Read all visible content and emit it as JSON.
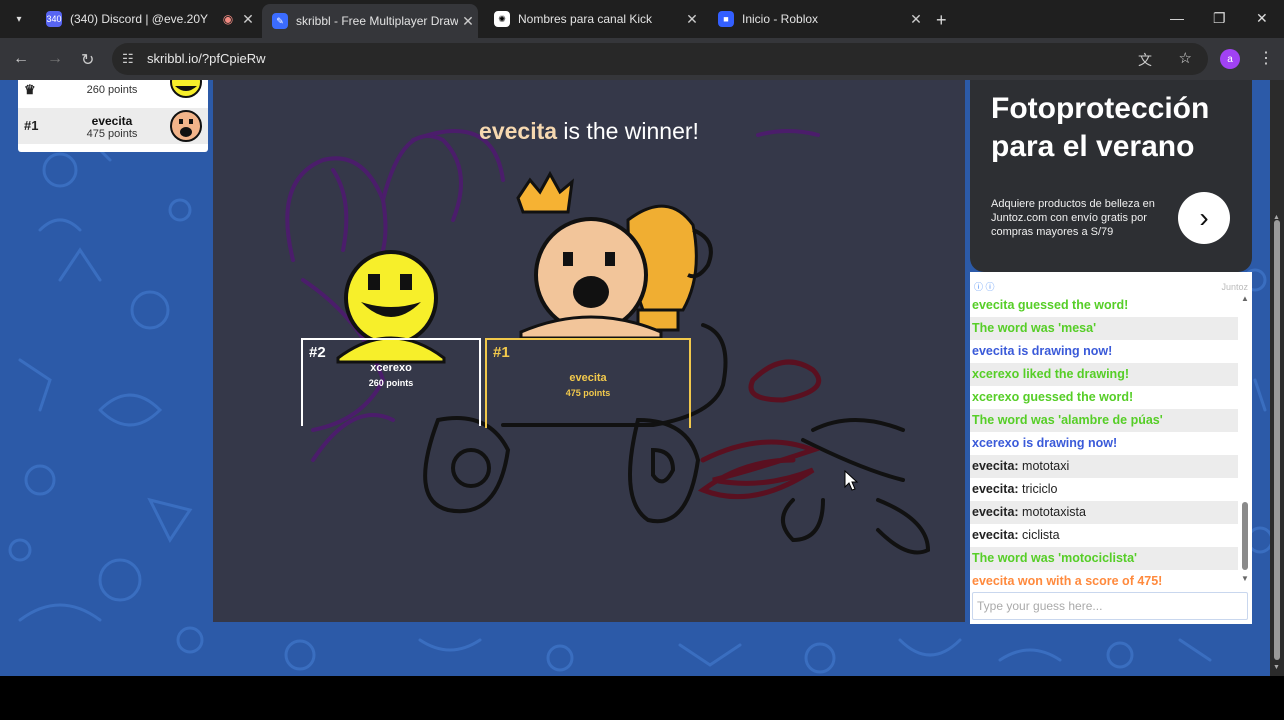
{
  "browser": {
    "tabs": [
      {
        "title": "(340) Discord | @eve.20Y",
        "badge": "340",
        "favicon_color": "#5865f2"
      },
      {
        "title": "skribbl - Free Multiplayer Drawi",
        "favicon_color": "#3b6cff"
      },
      {
        "title": "Nombres para canal Kick",
        "favicon_color": "#ffffff"
      },
      {
        "title": "Inicio - Roblox",
        "favicon_color": "#335fff"
      }
    ],
    "url": "skribbl.io/?pfCpieRw",
    "profile_initial": "a"
  },
  "players": [
    {
      "rank": "",
      "name": "",
      "points": "260 points"
    },
    {
      "rank": "#1",
      "name": "evecita",
      "points": "475 points"
    }
  ],
  "winner": {
    "name": "evecita",
    "suffix": " is the winner!"
  },
  "podium": [
    {
      "rank": "#2",
      "name": "xcerexo",
      "points": "260 points"
    },
    {
      "rank": "#1",
      "name": "evecita",
      "points": "475 points"
    }
  ],
  "ad": {
    "headline": "Fotoprotección para el verano",
    "body": "Adquiere productos de belleza en Juntoz.com con envío gratis por compras mayores a S/79",
    "brand": "Juntoz"
  },
  "chat": {
    "messages": [
      {
        "style": "green",
        "user": "",
        "text": "evecita guessed the word!"
      },
      {
        "style": "green",
        "user": "",
        "text": "The word was 'mesa'"
      },
      {
        "style": "blue",
        "user": "",
        "text": "evecita is drawing now!"
      },
      {
        "style": "green",
        "user": "",
        "text": "xcerexo liked the drawing!"
      },
      {
        "style": "green",
        "user": "",
        "text": "xcerexo guessed the word!"
      },
      {
        "style": "green",
        "user": "",
        "text": "The word was 'alambre de púas'"
      },
      {
        "style": "blue",
        "user": "",
        "text": "xcerexo is drawing now!"
      },
      {
        "style": "user",
        "user": "evecita:",
        "text": " mototaxi"
      },
      {
        "style": "user",
        "user": "evecita:",
        "text": " triciclo"
      },
      {
        "style": "user",
        "user": "evecita:",
        "text": " mototaxista"
      },
      {
        "style": "user",
        "user": "evecita:",
        "text": " ciclista"
      },
      {
        "style": "green",
        "user": "",
        "text": "The word was 'motociclista'"
      },
      {
        "style": "orange",
        "user": "",
        "text": "evecita won with a score of 475!"
      }
    ],
    "placeholder": "Type your guess here..."
  },
  "colors": {
    "page_bg": "#2c5aa8",
    "canvas_bg": "#353849",
    "gold": "#f2c94c",
    "green": "#56ce27",
    "blue": "#3a5ad9",
    "orange": "#ff8a3d"
  }
}
